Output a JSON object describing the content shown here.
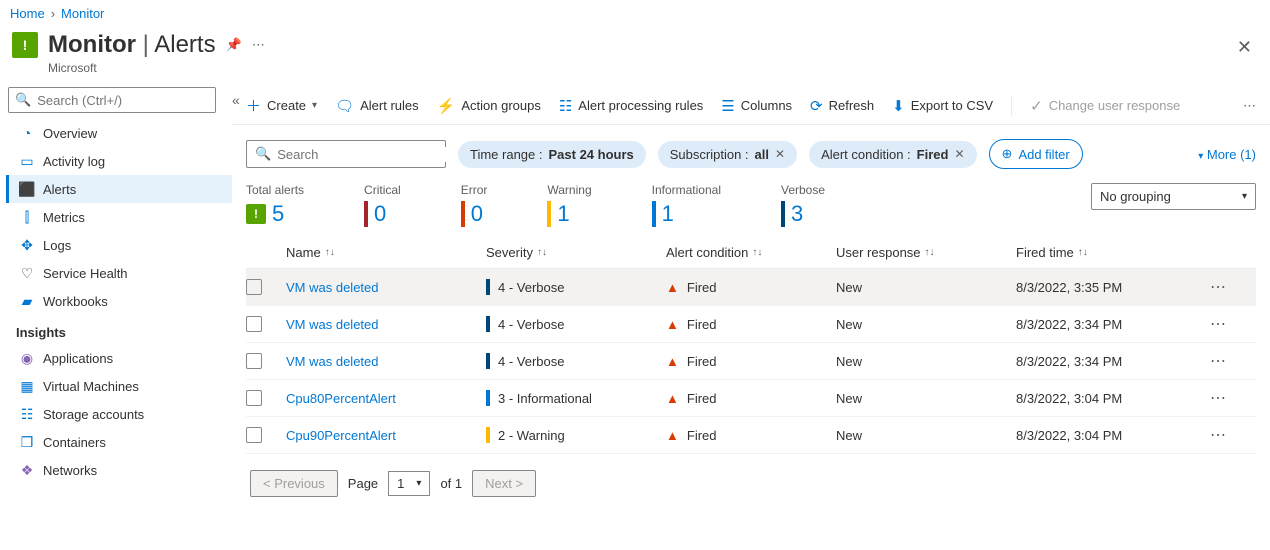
{
  "breadcrumb": {
    "home": "Home",
    "current": "Monitor"
  },
  "header": {
    "title_service": "Monitor",
    "title_section": "Alerts",
    "subtitle": "Microsoft"
  },
  "sidebar": {
    "search_placeholder": "Search (Ctrl+/)",
    "items": [
      {
        "label": "Overview",
        "icon": "◔",
        "color": "#0078d4"
      },
      {
        "label": "Activity log",
        "icon": "▭",
        "color": "#0078d4"
      },
      {
        "label": "Alerts",
        "icon": "⬛",
        "color": "#57a300",
        "active": true
      },
      {
        "label": "Metrics",
        "icon": "⫿",
        "color": "#0078d4"
      },
      {
        "label": "Logs",
        "icon": "✥",
        "color": "#0078d4"
      },
      {
        "label": "Service Health",
        "icon": "♡",
        "color": "#323130"
      },
      {
        "label": "Workbooks",
        "icon": "▰",
        "color": "#0078d4"
      }
    ],
    "insights_header": "Insights",
    "insights": [
      {
        "label": "Applications",
        "icon": "◉",
        "color": "#8764b8"
      },
      {
        "label": "Virtual Machines",
        "icon": "▦",
        "color": "#0078d4"
      },
      {
        "label": "Storage accounts",
        "icon": "☷",
        "color": "#0078d4"
      },
      {
        "label": "Containers",
        "icon": "❒",
        "color": "#0078d4"
      },
      {
        "label": "Networks",
        "icon": "❖",
        "color": "#8764b8"
      }
    ]
  },
  "toolbar": {
    "create": "Create",
    "alert_rules": "Alert rules",
    "action_groups": "Action groups",
    "alert_processing": "Alert processing rules",
    "columns": "Columns",
    "refresh": "Refresh",
    "export": "Export to CSV",
    "change_response": "Change user response"
  },
  "filters": {
    "search_placeholder": "Search",
    "time_label": "Time range : ",
    "time_value": "Past 24 hours",
    "sub_label": "Subscription : ",
    "sub_value": "all",
    "cond_label": "Alert condition : ",
    "cond_value": "Fired",
    "add_filter": "Add filter",
    "more": "More (1)"
  },
  "summary": {
    "total_label": "Total alerts",
    "total_value": "5",
    "critical_label": "Critical",
    "critical_value": "0",
    "error_label": "Error",
    "error_value": "0",
    "warning_label": "Warning",
    "warning_value": "1",
    "info_label": "Informational",
    "info_value": "1",
    "verbose_label": "Verbose",
    "verbose_value": "3",
    "grouping": "No grouping"
  },
  "columns": {
    "name": "Name",
    "severity": "Severity",
    "condition": "Alert condition",
    "response": "User response",
    "fired": "Fired time"
  },
  "rows": [
    {
      "name": "VM was deleted",
      "severity": "4 - Verbose",
      "sev_class": "clr-verbose",
      "condition": "Fired",
      "response": "New",
      "fired": "8/3/2022, 3:35 PM",
      "hovered": true
    },
    {
      "name": "VM was deleted",
      "severity": "4 - Verbose",
      "sev_class": "clr-verbose",
      "condition": "Fired",
      "response": "New",
      "fired": "8/3/2022, 3:34 PM"
    },
    {
      "name": "VM was deleted",
      "severity": "4 - Verbose",
      "sev_class": "clr-verbose",
      "condition": "Fired",
      "response": "New",
      "fired": "8/3/2022, 3:34 PM"
    },
    {
      "name": "Cpu80PercentAlert",
      "severity": "3 - Informational",
      "sev_class": "clr-info",
      "condition": "Fired",
      "response": "New",
      "fired": "8/3/2022, 3:04 PM"
    },
    {
      "name": "Cpu90PercentAlert",
      "severity": "2 - Warning",
      "sev_class": "clr-warning",
      "condition": "Fired",
      "response": "New",
      "fired": "8/3/2022, 3:04 PM"
    }
  ],
  "pager": {
    "prev": "< Previous",
    "page_label": "Page",
    "page_value": "1",
    "of_label": "of 1",
    "next": "Next >"
  }
}
